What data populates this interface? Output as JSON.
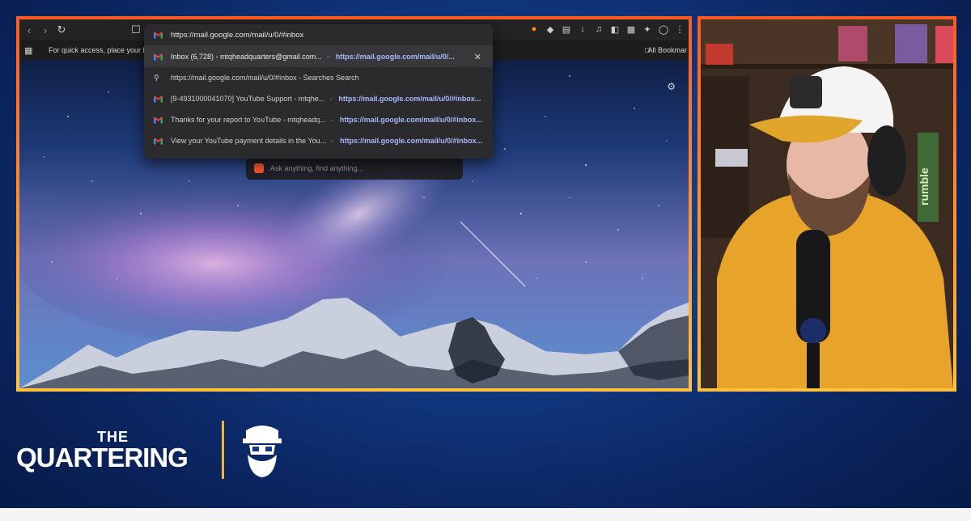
{
  "browser": {
    "url": "https://mail.google.com/mail/u/0/#inbox",
    "bookmarks_hint": "For quick access, place your bookm",
    "all_bookmarks": "All Bookmar",
    "search_placeholder": "Ask anything, find anything..."
  },
  "suggestions": [
    {
      "text": "Inbox (6,728) - mtqheadquarters@gmail.com...",
      "sep": "-",
      "url": "https://mail.google.com/mail/u/0/...",
      "icon": "gmail-icon",
      "selected": true
    },
    {
      "text": "https://mail.google.com/mail/u/0/#inbox - Searches Search",
      "sep": "",
      "url": "",
      "icon": "search-icon"
    },
    {
      "text": "[9-4931000041070] YouTube Support - mtqhe...",
      "sep": "-",
      "url": "https://mail.google.com/mail/u/0/#inbox...",
      "icon": "gmail-icon"
    },
    {
      "text": "Thanks for your report to YouTube - mtqheadq...",
      "sep": "-",
      "url": "https://mail.google.com/mail/u/0/#inbox...",
      "icon": "gmail-icon"
    },
    {
      "text": "View your YouTube payment details in the You...",
      "sep": "-",
      "url": "https://mail.google.com/mail/u/0/#inbox...",
      "icon": "gmail-icon"
    }
  ],
  "branding": {
    "the": "THE",
    "quartering": "QUARTERING"
  },
  "webcam": {
    "rumble_sign": "rumble"
  },
  "colors": {
    "frame_top": "#ff5a1f",
    "frame_bottom": "#ffc23a",
    "background": "#123a85",
    "divider": "#f3b23a"
  }
}
